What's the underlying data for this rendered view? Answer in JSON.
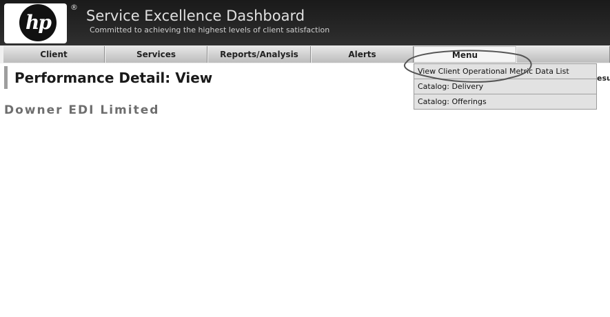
{
  "header": {
    "logo_text": "hp",
    "registered_mark": "®",
    "title": "Service Excellence Dashboard",
    "subtitle": "Committed to achieving the highest levels of client satisfaction"
  },
  "nav": {
    "items": [
      {
        "label": "Client"
      },
      {
        "label": "Services"
      },
      {
        "label": "Reports/Analysis"
      },
      {
        "label": "Alerts"
      },
      {
        "label": "Menu",
        "active": true
      }
    ]
  },
  "menu_dropdown": {
    "items": [
      {
        "label": "View Client Operational Metric Data List"
      },
      {
        "label": "Catalog: Delivery"
      },
      {
        "label": "Catalog: Offerings"
      }
    ]
  },
  "page": {
    "title": "Performance Detail: View",
    "right_clipped_text": "esu",
    "client_name": "Downer EDI Limited"
  },
  "colors": {
    "header_bg": "#1a1a1a",
    "nav_bg": "#cfcfcf",
    "dropdown_bg": "#e2e2e2",
    "client_name": "#6e6e6e"
  }
}
